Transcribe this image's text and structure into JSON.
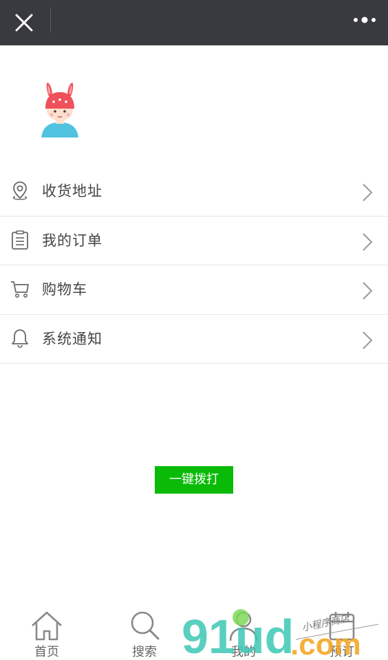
{
  "header": {
    "close_icon": "close-icon",
    "more_icon": "more-dots-icon"
  },
  "profile": {
    "avatar_icon": "bunny-hat-avatar"
  },
  "menu": {
    "items": [
      {
        "label": "收货地址",
        "icon": "location-pin-icon"
      },
      {
        "label": "我的订单",
        "icon": "clipboard-icon"
      },
      {
        "label": "购物车",
        "icon": "cart-icon"
      },
      {
        "label": "系统通知",
        "icon": "bell-icon"
      }
    ]
  },
  "call_button": {
    "label": "一键拨打",
    "color": "#09bb07"
  },
  "tabbar": {
    "tabs": [
      {
        "label": "首页",
        "icon": "home-icon"
      },
      {
        "label": "搜索",
        "icon": "search-icon"
      },
      {
        "label": "我的",
        "icon": "user-icon"
      },
      {
        "label": "预订",
        "icon": "booking-icon"
      }
    ]
  },
  "watermark": {
    "text_main": "91ud",
    "text_suffix": ".com",
    "text_tagline": "小程序商店"
  },
  "colors": {
    "topbar": "#393a3f",
    "accent_green": "#09bb07",
    "icon_gray": "#666666",
    "divider": "#e6e6e6"
  }
}
